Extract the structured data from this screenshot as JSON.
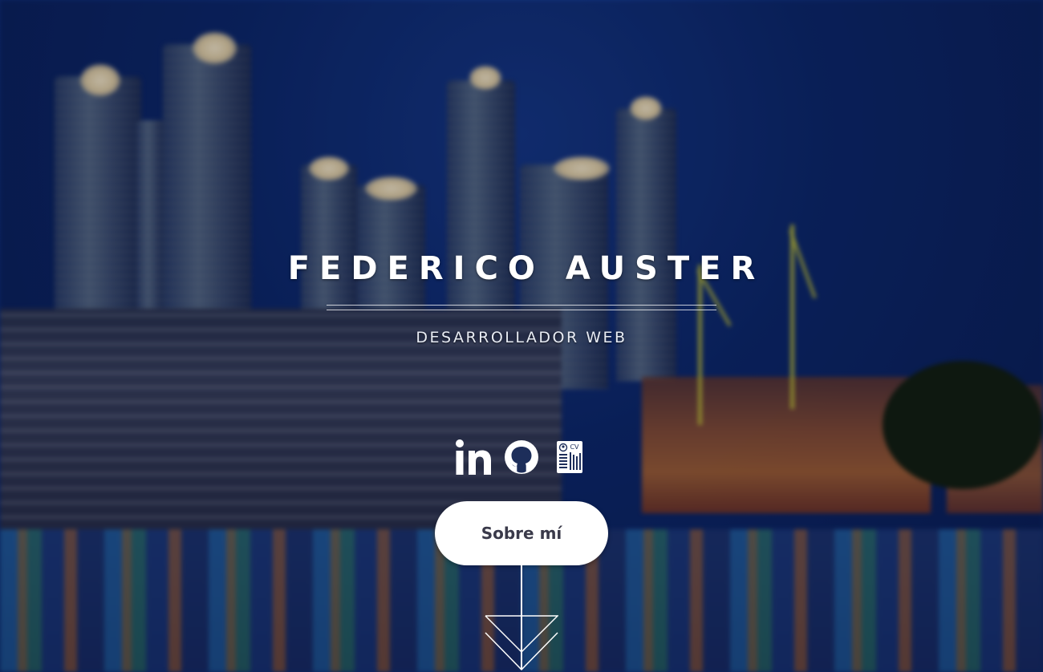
{
  "hero": {
    "name": "FEDERICO AUSTER",
    "tagline": "DESARROLLADOR WEB"
  },
  "socials": [
    {
      "icon": "linkedin-icon"
    },
    {
      "icon": "github-icon"
    },
    {
      "icon": "cv-document-icon",
      "label": "CV"
    }
  ],
  "about_button": {
    "label": "Sobre mí"
  },
  "scroll_indicator": {
    "icon": "double-chevron-down-icon"
  },
  "colors": {
    "text": "#ffffff",
    "button_background": "#ffffff",
    "button_text": "#3a3a4a",
    "sky": "#0d2a6e"
  }
}
